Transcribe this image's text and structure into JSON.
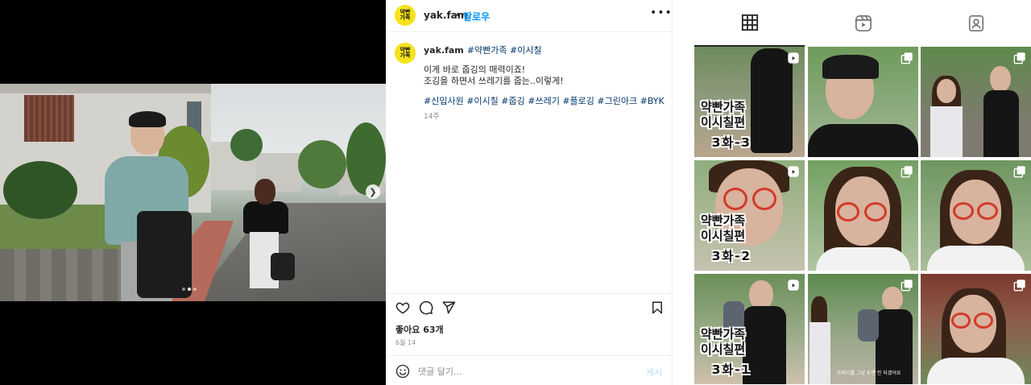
{
  "post": {
    "username": "yak.fam",
    "avatar_text": "약빤\n가족",
    "separator": "•",
    "follow_label": "팔로우",
    "more_label": "•••",
    "carousel": {
      "active_index": 2,
      "total": 3
    },
    "caption": {
      "username": "yak.fam",
      "hashtags_line1": [
        "#약빤가족",
        "#이시칠"
      ],
      "body_line1": "이게 바로 줍깅의 매력이죠!",
      "body_line2": "조깅을 하면서 쓰레기를 줍는..이렇게!",
      "hashtags": [
        "#신입사원",
        "#이시칠",
        "#줍깅",
        "#쓰레기",
        "#플로깅",
        "#그린아크",
        "#BYK"
      ],
      "time_ago": "14주"
    },
    "likes_label": "좋아요 63개",
    "date_label": "6월 14",
    "comment": {
      "placeholder": "댓글 달기...",
      "post_label": "게시"
    }
  },
  "icons": {
    "like": "heart-icon",
    "comment": "comment-icon",
    "share": "send-icon",
    "save": "bookmark-icon",
    "emoji": "smiley-icon",
    "next": "chevron-right-icon"
  },
  "profile_tabs": [
    {
      "name": "posts",
      "icon": "grid-icon",
      "active": true
    },
    {
      "name": "reels",
      "icon": "reels-icon",
      "active": false
    },
    {
      "name": "tagged",
      "icon": "tagged-user-icon",
      "active": false
    }
  ],
  "grid": [
    {
      "title_line1": "약빤가족",
      "title_line2": "이시칠편",
      "episode": "3화-3",
      "type": "reel"
    },
    {
      "type": "carousel"
    },
    {
      "type": "carousel"
    },
    {
      "title_line1": "약빤가족",
      "title_line2": "이시칠편",
      "episode": "3화-2",
      "type": "reel"
    },
    {
      "type": "carousel"
    },
    {
      "type": "carousel"
    },
    {
      "title_line1": "약빤가족",
      "title_line2": "이시칠편",
      "episode": "3화-1",
      "type": "reel"
    },
    {
      "type": "carousel",
      "subtitle": "쓰레기를 그냥 두면 안 되겠어요"
    },
    {
      "type": "carousel"
    }
  ],
  "colors": {
    "follow": "#0095f6",
    "hashtag": "#00376b",
    "avatar_bg": "#f7e21d",
    "muted": "#8e8e8e"
  }
}
